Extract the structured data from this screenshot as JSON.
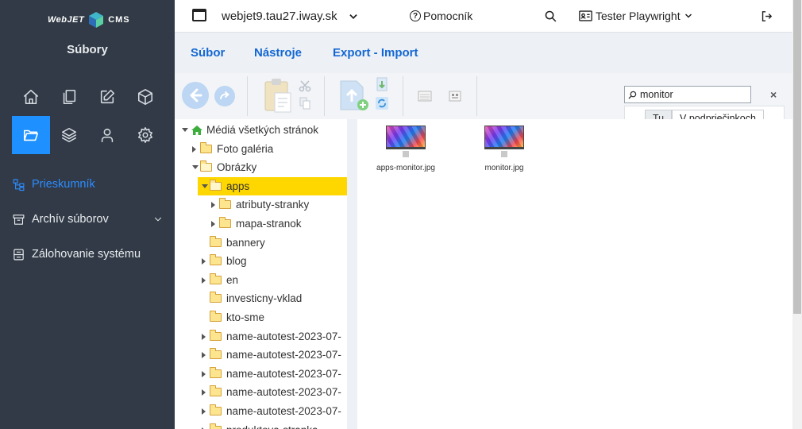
{
  "brand": {
    "logo_left": "WebJET",
    "logo_right": "CMS"
  },
  "sidebar": {
    "title": "Súbory",
    "icons": [
      {
        "name": "home-icon"
      },
      {
        "name": "pages-icon"
      },
      {
        "name": "edit-icon"
      },
      {
        "name": "box-icon"
      },
      {
        "name": "folder-icon",
        "active": true
      },
      {
        "name": "layers-icon"
      },
      {
        "name": "user-icon"
      },
      {
        "name": "settings-icon"
      }
    ],
    "menu": [
      {
        "label": "Prieskumník",
        "icon": "tree-icon",
        "active": true
      },
      {
        "label": "Archív súborov",
        "icon": "archive-icon",
        "has_chevron": true
      },
      {
        "label": "Zálohovanie systému",
        "icon": "backup-icon"
      }
    ]
  },
  "topbar": {
    "domain": "webjet9.tau27.iway.sk",
    "help": "Pomocník",
    "user": "Tester Playwright"
  },
  "tabs": [
    {
      "label": "Súbor",
      "active": true
    },
    {
      "label": "Nástroje"
    },
    {
      "label": "Export - Import"
    }
  ],
  "search": {
    "value": "monitor",
    "scope_here": "Tu",
    "scope_subfolders": "V podpriečinkoch"
  },
  "tree": {
    "root": "Médiá všetkých stránok",
    "items": [
      {
        "label": "Foto galéria",
        "level": 1,
        "toggle": "right"
      },
      {
        "label": "Obrázky",
        "level": 1,
        "toggle": "down"
      },
      {
        "label": "apps",
        "level": 2,
        "toggle": "down",
        "selected": true
      },
      {
        "label": "atributy-stranky",
        "level": 3,
        "toggle": "right"
      },
      {
        "label": "mapa-stranok",
        "level": 3,
        "toggle": "right"
      },
      {
        "label": "bannery",
        "level": 2,
        "toggle": "none"
      },
      {
        "label": "blog",
        "level": 2,
        "toggle": "right"
      },
      {
        "label": "en",
        "level": 2,
        "toggle": "right"
      },
      {
        "label": "investicny-vklad",
        "level": 2,
        "toggle": "none"
      },
      {
        "label": "kto-sme",
        "level": 2,
        "toggle": "none"
      },
      {
        "label": "name-autotest-2023-07-",
        "level": 2,
        "toggle": "right"
      },
      {
        "label": "name-autotest-2023-07-",
        "level": 2,
        "toggle": "right"
      },
      {
        "label": "name-autotest-2023-07-",
        "level": 2,
        "toggle": "right"
      },
      {
        "label": "name-autotest-2023-07-",
        "level": 2,
        "toggle": "right"
      },
      {
        "label": "name-autotest-2023-07-",
        "level": 2,
        "toggle": "right"
      },
      {
        "label": "produktova-stranka",
        "level": 2,
        "toggle": "right"
      }
    ]
  },
  "files": [
    {
      "name": "apps-monitor.jpg"
    },
    {
      "name": "monitor.jpg"
    }
  ],
  "colors": {
    "sidebar_bg": "#313a46",
    "accent": "#1e90ff",
    "tab_text": "#1467d3",
    "selected_row": "#ffd700"
  }
}
